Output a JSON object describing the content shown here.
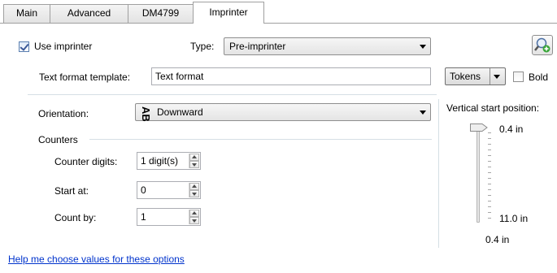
{
  "tabs": [
    {
      "label": "Main"
    },
    {
      "label": "Advanced"
    },
    {
      "label": "DM4799"
    },
    {
      "label": "Imprinter"
    }
  ],
  "use_imprinter": {
    "label": "Use imprinter",
    "checked": true
  },
  "type": {
    "label": "Type:",
    "value": "Pre-imprinter"
  },
  "search_button": {
    "icon": "magnifier-plus-icon"
  },
  "text_format": {
    "label": "Text format template:",
    "value": "Text format"
  },
  "tokens": {
    "label": "Tokens"
  },
  "bold": {
    "label": "Bold",
    "checked": false
  },
  "orientation": {
    "label": "Orientation:",
    "value": "Downward",
    "icon": "rotated-ab-glyph-icon"
  },
  "counters": {
    "heading": "Counters",
    "digits": {
      "label": "Counter digits:",
      "value": "1 digit(s)"
    },
    "start": {
      "label": "Start at:",
      "value": "0"
    },
    "countby": {
      "label": "Count by:",
      "value": "1"
    }
  },
  "vertical": {
    "label": "Vertical start position:",
    "top_value": "0.4 in",
    "bottom_value": "11.0 in",
    "current_value": "0.4 in"
  },
  "help_link": "Help me choose values for these options",
  "colors": {
    "link": "#0033cc",
    "tab_border": "#a0a0a0",
    "accent": "#3b5998"
  }
}
